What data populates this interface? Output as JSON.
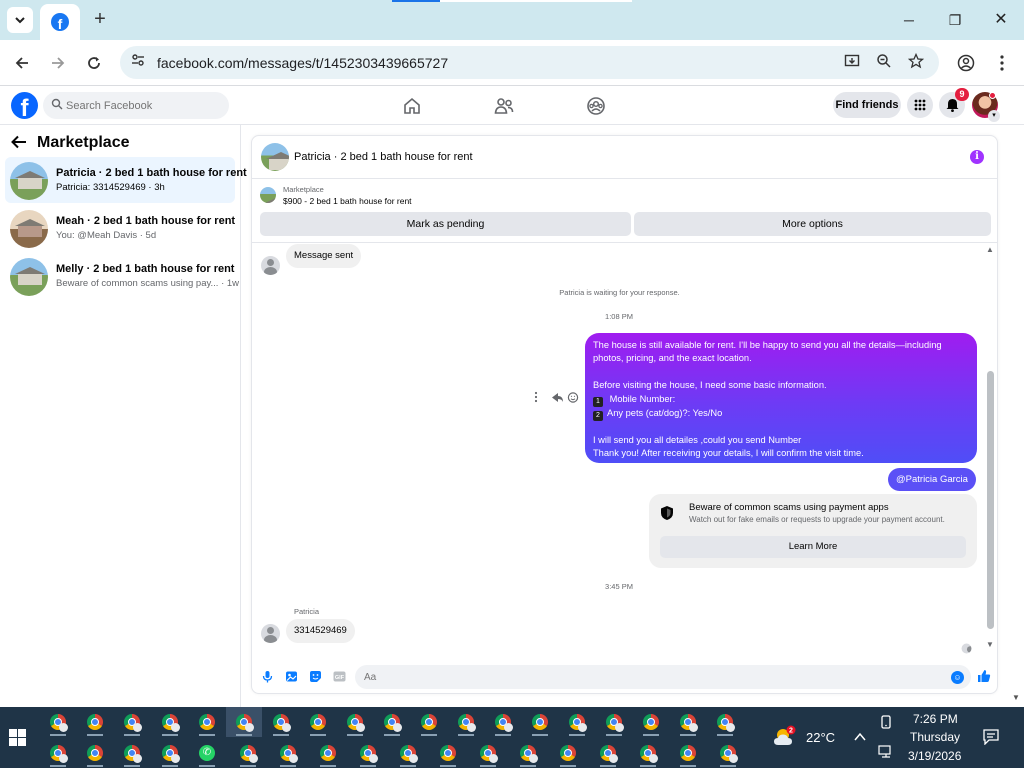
{
  "browser": {
    "url": "facebook.com/messages/t/1452303439665727",
    "new_tab_symbol": "+",
    "window_controls": {
      "minimize": "─",
      "restore": "❐",
      "close": "✕"
    }
  },
  "fb_header": {
    "search_placeholder": "Search Facebook",
    "find_friends_label": "Find friends",
    "notification_count": "9"
  },
  "sidebar": {
    "title": "Marketplace",
    "conversations": [
      {
        "title": "Patricia · 2 bed 1 bath house for rent",
        "subtitle": "Patricia: 3314529469 · 3h",
        "active": true
      },
      {
        "title": "Meah · 2 bed 1 bath house for rent",
        "subtitle": "You: @Meah Davis · 5d",
        "active": false
      },
      {
        "title": "Melly · 2 bed 1 bath house for rent",
        "subtitle": "Beware of common scams using pay... · 1w",
        "active": false
      }
    ]
  },
  "chat": {
    "header_title": "Patricia · 2 bed 1 bath house for rent",
    "listing": {
      "label": "Marketplace",
      "title": "$900 - 2 bed 1 bath house for rent",
      "mark_pending_label": "Mark as pending",
      "more_options_label": "More options"
    },
    "messages": {
      "first_in": "Message sent",
      "waiting_note": "Patricia is waiting for your response.",
      "timestamp_1": "1:08 PM",
      "out_para_1": "The house is still available for rent. I'll be happy to send you all the details—including photos, pricing, and the exact location.",
      "out_para_2": "Before visiting the house, I need some basic information.",
      "out_item_1_num": "1",
      "out_item_1": "Mobile Number:",
      "out_item_2_num": "2",
      "out_item_2": "Any pets (cat/dog)?: Yes/No",
      "out_para_3a": "I will send you all detailes ,could you send Number",
      "out_para_3b": "Thank you! After receiving your details, I will confirm the visit time.",
      "mention": "@Patricia Garcia",
      "scam_title": "Beware of common scams using payment apps",
      "scam_desc": "Watch out for fake emails or requests to upgrade your payment account.",
      "learn_more_label": "Learn More",
      "timestamp_2": "3:45 PM",
      "sender_name": "Patricia",
      "last_in": "3314529469"
    },
    "composer_placeholder": "Aa"
  },
  "taskbar": {
    "weather_badge": "2",
    "temperature": "22°C",
    "time": "7:26 PM",
    "day": "Thursday",
    "date": "3/19/2026"
  },
  "colors": {
    "fb_blue": "#0866ff",
    "messenger_purple": "#a033ff",
    "outgoing_gradient_start": "#a01cf0",
    "outgoing_gradient_end": "#4f4ef7",
    "browser_tabstrip": "#cfe8ef",
    "taskbar": "#1f3447"
  }
}
